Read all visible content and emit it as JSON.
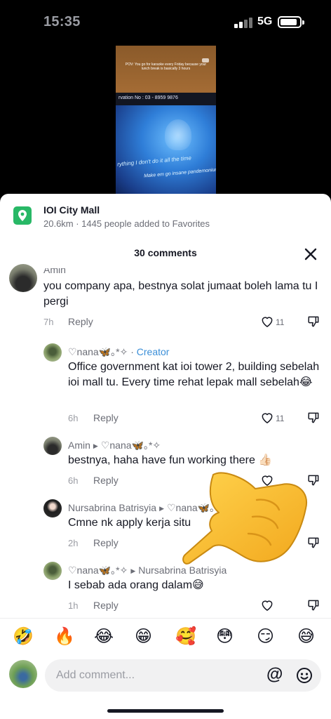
{
  "status_bar": {
    "time": "15:35",
    "network": "5G"
  },
  "video": {
    "caption": "POV: You go for karaoke every Friday because your lunch break is basically 3 hours",
    "reservation": "rvation No : 03 - 8959 9876",
    "lyric_1": "rything I don't do it all the time",
    "lyric_2": "Make em go insane pandemonium"
  },
  "place": {
    "name": "IOI City Mall",
    "meta": "20.6km · 1445 people added to Favorites"
  },
  "comments_header": {
    "count_label": "30 comments"
  },
  "comments": [
    {
      "user": "Amin",
      "text": "you company apa, bestnya solat jumaat boleh lama tu I pergi",
      "time": "7h",
      "reply": "Reply",
      "likes": "11"
    },
    {
      "user": "♡nana🦋｡*✧",
      "badge": "Creator",
      "text": "Office government kat ioi tower 2, building sebelah ioi mall tu. Every time rehat lepak mall sebelah😂",
      "time": "6h",
      "reply": "Reply",
      "likes": "11"
    },
    {
      "user": "Amin",
      "reply_to": "♡nana🦋｡*✧",
      "text": "bestnya, haha have fun working there 👍🏻",
      "time": "6h",
      "reply": "Reply"
    },
    {
      "user": "Nursabrina Batrisyia",
      "reply_to": "♡nana🦋｡*✧",
      "text": "Cmne nk apply kerja situ",
      "time": "2h",
      "reply": "Reply"
    },
    {
      "user": "♡nana🦋｡*✧",
      "reply_to": "Nursabrina Batrisyia",
      "text": "I sebab ada orang dalam😅",
      "time": "1h",
      "reply": "Reply"
    }
  ],
  "emoji_bar": [
    "🤣",
    "🔥",
    "😂",
    "😁",
    "🥰",
    "😳",
    "😏",
    "😅"
  ],
  "input": {
    "placeholder": "Add comment...",
    "mention_label": "@"
  },
  "colors": {
    "accent_green": "#28b866",
    "creator_blue": "#3b8fd8",
    "text": "#161823",
    "muted": "#6b6d76"
  }
}
